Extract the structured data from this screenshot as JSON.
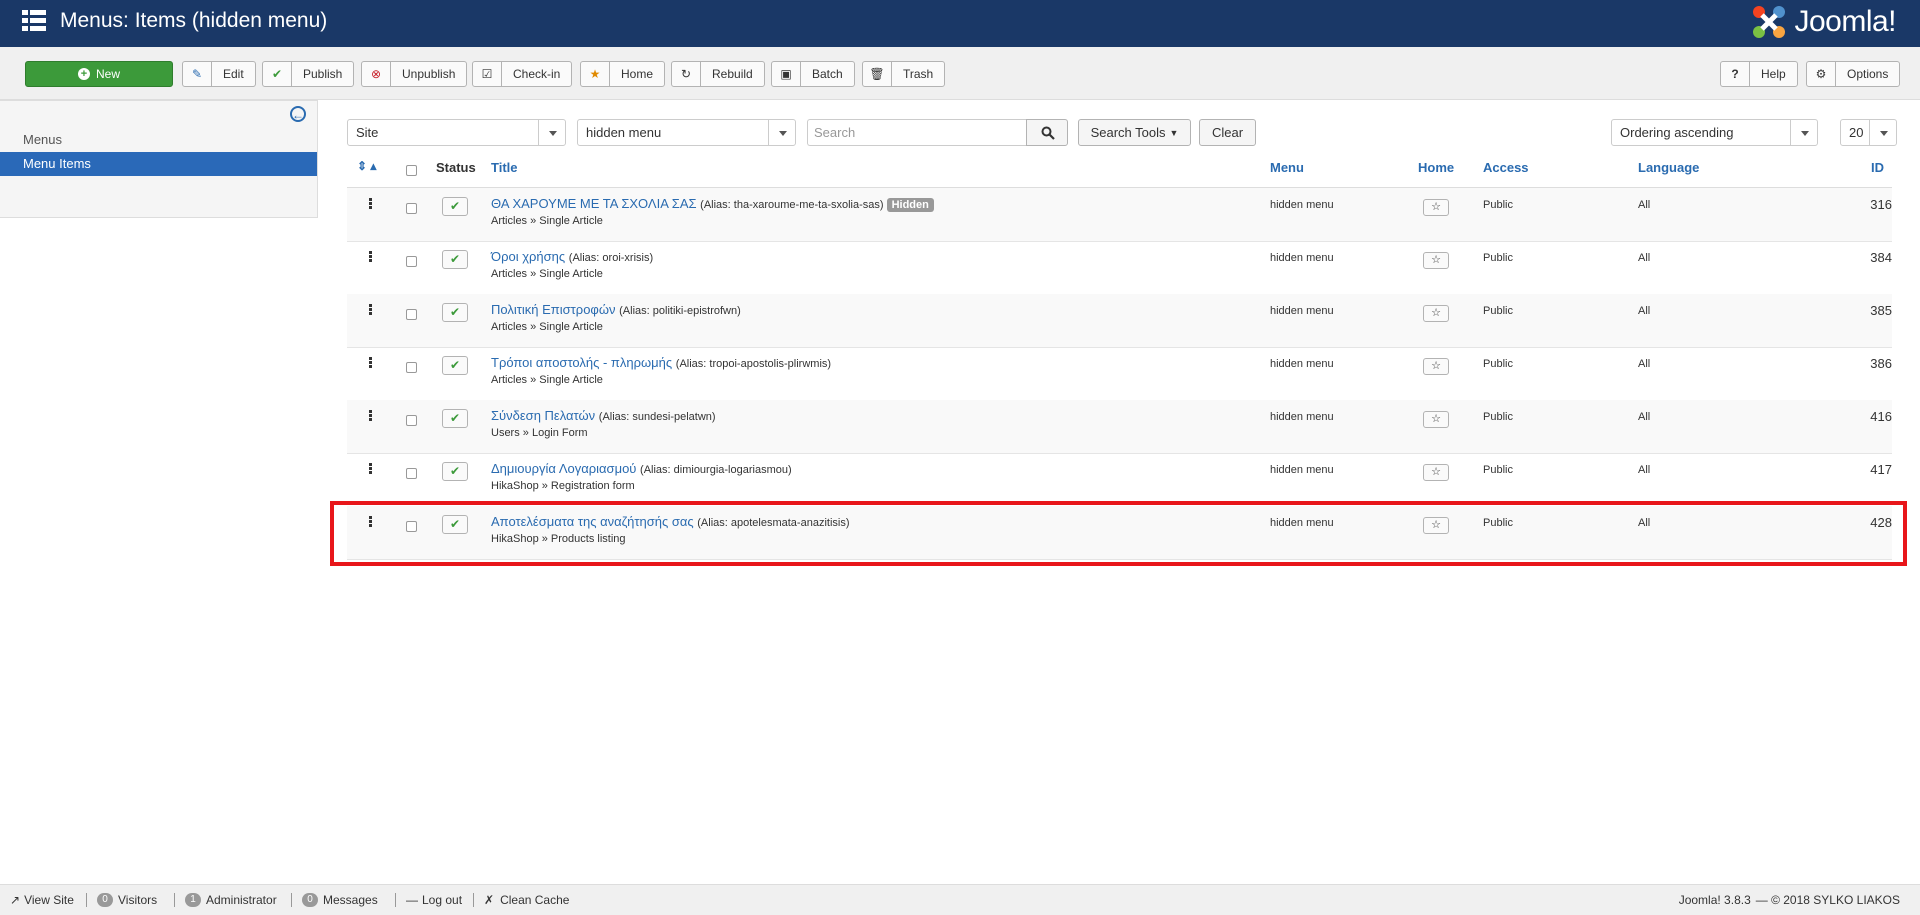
{
  "header": {
    "title": "Menus: Items (hidden menu)",
    "logo_text": "Joomla!"
  },
  "toolbar": {
    "new": "New",
    "edit": "Edit",
    "publish": "Publish",
    "unpublish": "Unpublish",
    "checkin": "Check-in",
    "home": "Home",
    "rebuild": "Rebuild",
    "batch": "Batch",
    "trash": "Trash",
    "help": "Help",
    "options": "Options"
  },
  "sidebar": {
    "items": [
      {
        "label": "Menus"
      },
      {
        "label": "Menu Items"
      }
    ]
  },
  "filters": {
    "client": "Site",
    "menutype": "hidden menu",
    "search_placeholder": "Search",
    "search_tools": "Search Tools",
    "clear": "Clear",
    "ordering": "Ordering ascending",
    "limit": "20"
  },
  "table": {
    "headers": {
      "status": "Status",
      "title": "Title",
      "menu": "Menu",
      "home": "Home",
      "access": "Access",
      "language": "Language",
      "id": "ID"
    },
    "rows": [
      {
        "title": "ΘΑ ΧΑΡΟΥΜΕ ΜΕ ΤΑ ΣΧΟΛΙΑ ΣΑΣ",
        "alias": "(Alias: tha-xaroume-me-ta-sxolia-sas)",
        "badge": "Hidden",
        "type": "Articles » Single Article",
        "menu": "hidden menu",
        "access": "Public",
        "language": "All",
        "id": "316"
      },
      {
        "title": "Όροι χρήσης",
        "alias": "(Alias: oroi-xrisis)",
        "type": "Articles » Single Article",
        "menu": "hidden menu",
        "access": "Public",
        "language": "All",
        "id": "384"
      },
      {
        "title": "Πολιτική Επιστροφών",
        "alias": "(Alias: politiki-epistrofwn)",
        "type": "Articles » Single Article",
        "menu": "hidden menu",
        "access": "Public",
        "language": "All",
        "id": "385"
      },
      {
        "title": "Τρόποι αποστολής - πληρωμής",
        "alias": "(Alias: tropoi-apostolis-plirwmis)",
        "type": "Articles » Single Article",
        "menu": "hidden menu",
        "access": "Public",
        "language": "All",
        "id": "386"
      },
      {
        "title": "Σύνδεση Πελατών",
        "alias": "(Alias: sundesi-pelatwn)",
        "type": "Users » Login Form",
        "menu": "hidden menu",
        "access": "Public",
        "language": "All",
        "id": "416"
      },
      {
        "title": "Δημιουργία Λογαριασμού",
        "alias": "(Alias: dimiourgia-logariasmou)",
        "type": "HikaShop » Registration form",
        "menu": "hidden menu",
        "access": "Public",
        "language": "All",
        "id": "417"
      },
      {
        "title": "Αποτελέσματα της αναζήτησής σας",
        "alias": "(Alias: apotelesmata-anazitisis)",
        "type": "HikaShop » Products listing",
        "menu": "hidden menu",
        "access": "Public",
        "language": "All",
        "id": "428"
      }
    ]
  },
  "footer": {
    "view_site": "View Site",
    "visitors_count": "0",
    "visitors": "Visitors",
    "admin_count": "1",
    "admin": "Administrator",
    "messages_count": "0",
    "messages": "Messages",
    "logout": "Log out",
    "clean_cache": "Clean Cache",
    "version": "Joomla! 3.8.3",
    "copyright": "— © 2018 SYLKO LIAKOS"
  },
  "colors": {
    "header": "#1a3867",
    "accent": "#2a6bb0",
    "new_button": "#3c9a3a",
    "highlight": "#e8161a"
  }
}
